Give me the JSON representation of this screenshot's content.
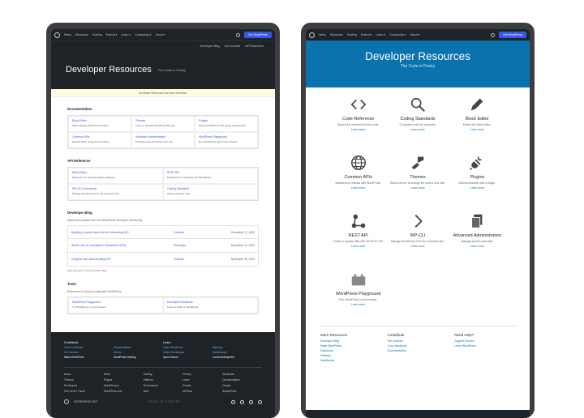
{
  "left": {
    "nav": {
      "items": [
        "News",
        "Showcase",
        "Hosting",
        "Extend ▾",
        "Learn ▾",
        "Community ▾",
        "About ▾"
      ],
      "cta": "Get WordPress"
    },
    "subnav": [
      "Developer Blog",
      "Get Involved",
      "API Reference"
    ],
    "hero": {
      "title": "Developer Resources",
      "subtitle": "The Code is Poetry"
    },
    "notice": "Developer Resources has been refreshed.",
    "sections": [
      {
        "title": "Documentation",
        "items": [
          {
            "link": "Block Editor",
            "desc": "Start building with the block editor."
          },
          {
            "link": "Themes",
            "desc": "Learn to develop WordPress themes."
          },
          {
            "link": "Plugins",
            "desc": "Extend WordPress with plugin development."
          },
          {
            "link": "Common APIs",
            "desc": "Explore APIs, hooks and functions."
          },
          {
            "link": "Advanced Administration",
            "desc": "Configure and administer your site."
          },
          {
            "link": "WordPress Playground",
            "desc": "Run WordPress right in the browser."
          }
        ]
      },
      {
        "title": "API Reference",
        "items": [
          {
            "link": "Block Editor",
            "desc": "Reference for the block editor packages."
          },
          {
            "link": "REST API",
            "desc": "Endpoints for interacting with WordPress."
          },
          {
            "link": "WP-CLI Commands",
            "desc": "Manage WordPress from the command line."
          },
          {
            "link": "Coding Standards",
            "desc": "Write consistent code."
          }
        ]
      }
    ],
    "blog": {
      "title": "Developer Blog",
      "intro": "News and updates from the WordPress developer community.",
      "rows": [
        {
          "name": "Building a custom block with the Interactivity API",
          "cat": "Tutorials",
          "date": "December 17, 2023"
        },
        {
          "name": "What's new for developers? (December 2023)",
          "cat": "Roundups",
          "date": "December 12, 2023"
        },
        {
          "name": "Using the new block bindings API",
          "cat": "Tutorials",
          "date": "November 30, 2023"
        }
      ],
      "see_all": "View all posts on the Developer Blog"
    },
    "tools": {
      "title": "Tools",
      "intro": "Resources to help you build with WordPress.",
      "items": [
        {
          "link": "WordPress Playground",
          "desc": "Try WordPress in your browser."
        },
        {
          "link": "Developer Handbook",
          "desc": "Learn to build for WordPress."
        }
      ]
    },
    "footer": {
      "cols": [
        {
          "h": "Contribute",
          "l": [
            "Core Contributor",
            "Get Involved"
          ],
          "w": "Make WordPress"
        },
        {
          "h": "",
          "l": [
            "Documentation",
            "Blocks"
          ],
          "w": "WordPress Hosting"
        },
        {
          "h": "Learn",
          "l": [
            "Learn WordPress",
            "Online Workshops"
          ],
          "w": "Open Source"
        },
        {
          "h": "",
          "l": [
            "Meetups",
            "WordCamps"
          ],
          "w": "Local development"
        }
      ],
      "links": [
        "About",
        "News",
        "Hosting",
        "Privacy",
        "Showcase",
        "Themes",
        "Plugins",
        "Patterns",
        "Learn",
        "Documentation",
        "Developers",
        "WordPress.tv",
        "Get Involved",
        "Events",
        "Donate",
        "Five for the Future",
        "WordPress.com",
        "Matt",
        "bbPress",
        "BuddyPress"
      ],
      "brand": "WORDPRESS.ORG",
      "code": "CODE IS POETRY"
    }
  },
  "right": {
    "nav": {
      "items": [
        "News",
        "Showcase",
        "Hosting",
        "Extend ▾",
        "Learn ▾",
        "Community ▾",
        "About ▾"
      ],
      "cta": "Get WordPress"
    },
    "hero": {
      "title": "Developer Resources",
      "subtitle": "The Code is Poetry"
    },
    "tiles": [
      {
        "icon": "code-icon",
        "name": "Code Reference",
        "desc": "Search the reference for the code.",
        "link": "Learn more"
      },
      {
        "icon": "magnifier-icon",
        "name": "Coding Standards",
        "desc": "Consistent code for everyone.",
        "link": "Learn more"
      },
      {
        "icon": "pencil-icon",
        "name": "Block Editor",
        "desc": "Extend the block editor.",
        "link": "Learn more"
      },
      {
        "icon": "globe-icon",
        "name": "Common APIs",
        "desc": "Interfaces to interact with WordPress.",
        "link": "Learn more"
      },
      {
        "icon": "brush-icon",
        "name": "Themes",
        "desc": "Build a theme to change the look of your site.",
        "link": "Learn more"
      },
      {
        "icon": "plug-icon",
        "name": "Plugins",
        "desc": "Add functionality with a plugin.",
        "link": "Learn more"
      },
      {
        "icon": "share-icon",
        "name": "REST API",
        "desc": "Create or update data with the REST API.",
        "link": "Learn more"
      },
      {
        "icon": "chevron-right-icon",
        "name": "WP-CLI",
        "desc": "Manage WordPress from the command line.",
        "link": "Learn more"
      },
      {
        "icon": "copy-icon",
        "name": "Advanced Administration",
        "desc": "Manage servers and sites.",
        "link": "Learn more"
      },
      {
        "icon": "playground-icon",
        "name": "WordPress Playground",
        "desc": "Run WordPress in the browser.",
        "link": "Learn more"
      }
    ],
    "bottom": [
      {
        "h": "More Resources",
        "l": [
          "Developer Blog",
          "Make WordPress",
          "Dashicons",
          "Meetups",
          "Handbooks"
        ]
      },
      {
        "h": "Contribute",
        "l": [
          "Get Involved",
          "Core Handbook",
          "Documentation"
        ]
      },
      {
        "h": "Need Help?",
        "l": [
          "Support Forums",
          "Learn WordPress"
        ]
      }
    ]
  }
}
